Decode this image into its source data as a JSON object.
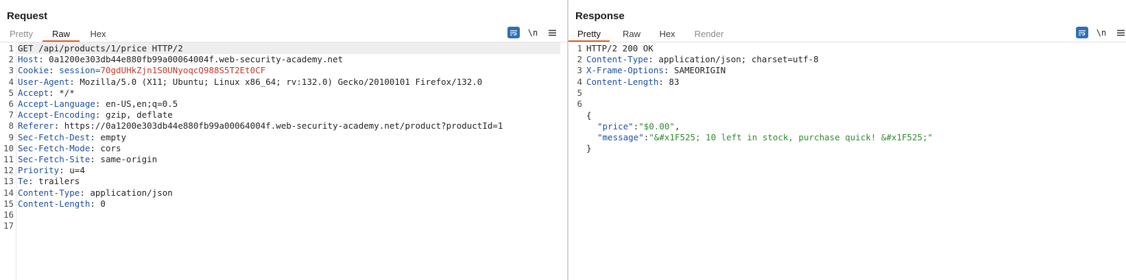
{
  "request": {
    "title": "Request",
    "tabs": [
      {
        "label": "Pretty",
        "state": "inactive"
      },
      {
        "label": "Raw",
        "state": "active"
      },
      {
        "label": "Hex",
        "state": "enabled"
      }
    ],
    "toolbar": {
      "newline_label": "\\n"
    },
    "lines": [
      {
        "n": "1",
        "key": "",
        "sep": "",
        "value": "GET /api/products/1/price HTTP/2"
      },
      {
        "n": "2",
        "key": "Host",
        "sep": ": ",
        "value": "0a1200e303db44e880fb99a00064004f.web-security-academy.net"
      },
      {
        "n": "3",
        "key": "Cookie",
        "sep": ": ",
        "value": "session=",
        "value2": "70gdUHkZjn1S0UNyoqcQ988S5T2Et0CF"
      },
      {
        "n": "4",
        "key": "User-Agent",
        "sep": ": ",
        "value": "Mozilla/5.0 (X11; Ubuntu; Linux x86_64; rv:132.0) Gecko/20100101 Firefox/132.0"
      },
      {
        "n": "5",
        "key": "Accept",
        "sep": ": ",
        "value": "*/*"
      },
      {
        "n": "6",
        "key": "Accept-Language",
        "sep": ": ",
        "value": "en-US,en;q=0.5"
      },
      {
        "n": "7",
        "key": "Accept-Encoding",
        "sep": ": ",
        "value": "gzip, deflate"
      },
      {
        "n": "8",
        "key": "Referer",
        "sep": ": ",
        "value": "https://0a1200e303db44e880fb99a00064004f.web-security-academy.net/product?productId=1"
      },
      {
        "n": "9",
        "key": "Sec-Fetch-Dest",
        "sep": ": ",
        "value": "empty"
      },
      {
        "n": "10",
        "key": "Sec-Fetch-Mode",
        "sep": ": ",
        "value": "cors"
      },
      {
        "n": "11",
        "key": "Sec-Fetch-Site",
        "sep": ": ",
        "value": "same-origin"
      },
      {
        "n": "12",
        "key": "Priority",
        "sep": ": ",
        "value": "u=4"
      },
      {
        "n": "13",
        "key": "Te",
        "sep": ": ",
        "value": "trailers"
      },
      {
        "n": "14",
        "key": "Content-Type",
        "sep": ": ",
        "value": "application/json"
      },
      {
        "n": "15",
        "key": "Content-Length",
        "sep": ": ",
        "value": "0"
      },
      {
        "n": "16",
        "key": "",
        "sep": "",
        "value": ""
      },
      {
        "n": "17",
        "key": "",
        "sep": "",
        "value": ""
      }
    ]
  },
  "response": {
    "title": "Response",
    "tabs": [
      {
        "label": "Pretty",
        "state": "active"
      },
      {
        "label": "Raw",
        "state": "enabled"
      },
      {
        "label": "Hex",
        "state": "enabled"
      },
      {
        "label": "Render",
        "state": "inactive"
      }
    ],
    "toolbar": {
      "newline_label": "\\n"
    },
    "headers": [
      {
        "n": "1",
        "key": "",
        "sep": "",
        "value": "HTTP/2 200 OK"
      },
      {
        "n": "2",
        "key": "Content-Type",
        "sep": ": ",
        "value": "application/json; charset=utf-8"
      },
      {
        "n": "3",
        "key": "X-Frame-Options",
        "sep": ": ",
        "value": "SAMEORIGIN"
      },
      {
        "n": "4",
        "key": "Content-Length",
        "sep": ": ",
        "value": "83"
      },
      {
        "n": "5",
        "key": "",
        "sep": "",
        "value": ""
      },
      {
        "n": "6",
        "key": "",
        "sep": "",
        "value": ""
      }
    ],
    "body": {
      "open": "{",
      "close": "}",
      "price_key": "\"price\"",
      "price_value": "\"$0.00\"",
      "message_key": "\"message\"",
      "message_value": "\"&#x1F525; 10 left in stock, purchase quick! &#x1F525;\""
    }
  },
  "colors": {
    "accent": "#e2591a",
    "button_blue": "#2f6fb3",
    "header_key": "#1b4fa0",
    "cookie_value": "#c0392b",
    "json_string": "#2e8b2e"
  }
}
